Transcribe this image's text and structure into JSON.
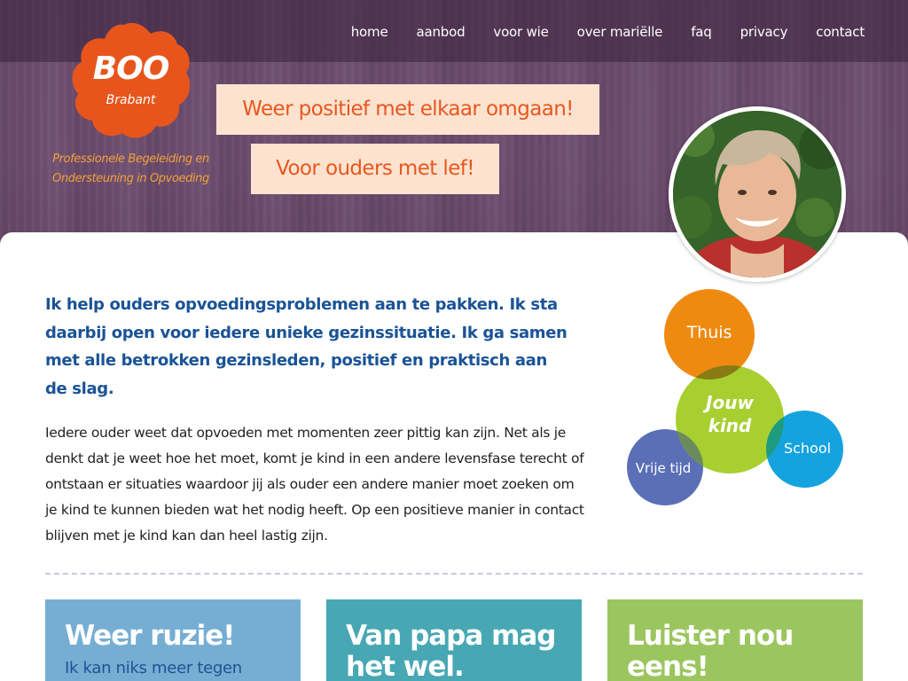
{
  "nav": {
    "items": [
      {
        "label": "home"
      },
      {
        "label": "aanbod"
      },
      {
        "label": "voor wie"
      },
      {
        "label": "over mariëlle"
      },
      {
        "label": "faq"
      },
      {
        "label": "privacy"
      },
      {
        "label": "contact"
      }
    ]
  },
  "logo": {
    "title": "BOO",
    "subtitle": "Brabant",
    "tagline_line1": "Professionele Begeleiding en",
    "tagline_line2": "Ondersteuning in Opvoeding"
  },
  "hero": {
    "slogan_1": "Weer positief met elkaar omgaan!",
    "slogan_2": "Voor ouders met lef!"
  },
  "intro": {
    "lead": "Ik help ouders opvoedingsproblemen aan te pakken. Ik sta daarbij open voor iedere unieke gezinssituatie. Ik ga samen met alle betrokken gezinsleden, positief en praktisch aan de slag.",
    "body": "Iedere ouder weet dat opvoeden met momenten zeer pittig kan zijn. Net als je denkt dat je weet hoe het moet, komt je kind in een andere levensfase terecht of ontstaan er situaties waardoor jij als ouder een andere manier moet zoeken om je kind te kunnen bieden wat het nodig heeft. Op een positieve manier in contact blijven met je kind kan dan heel lastig zijn."
  },
  "venn": {
    "thuis": "Thuis",
    "kind_line1": "Jouw",
    "kind_line2": "kind",
    "school": "School",
    "vrije_tijd": "Vrije tijd"
  },
  "cards": [
    {
      "title": "Weer ruzie!",
      "subtitle": "Ik kan niks meer tegen"
    },
    {
      "title": "Van papa mag het wel.",
      "subtitle": ""
    },
    {
      "title": "Luister nou eens!",
      "subtitle": ""
    }
  ],
  "colors": {
    "brand_orange": "#e8551c",
    "nav_bg": "#3a223c",
    "intro_blue": "#1a5396",
    "thuis": "#ef8a10",
    "kind": "#9fca1a",
    "school": "#14a3df",
    "vrije_tijd": "#5b6fb7",
    "card_1": "#76aed3",
    "card_2": "#47a8b4",
    "card_3": "#9bc65f"
  }
}
